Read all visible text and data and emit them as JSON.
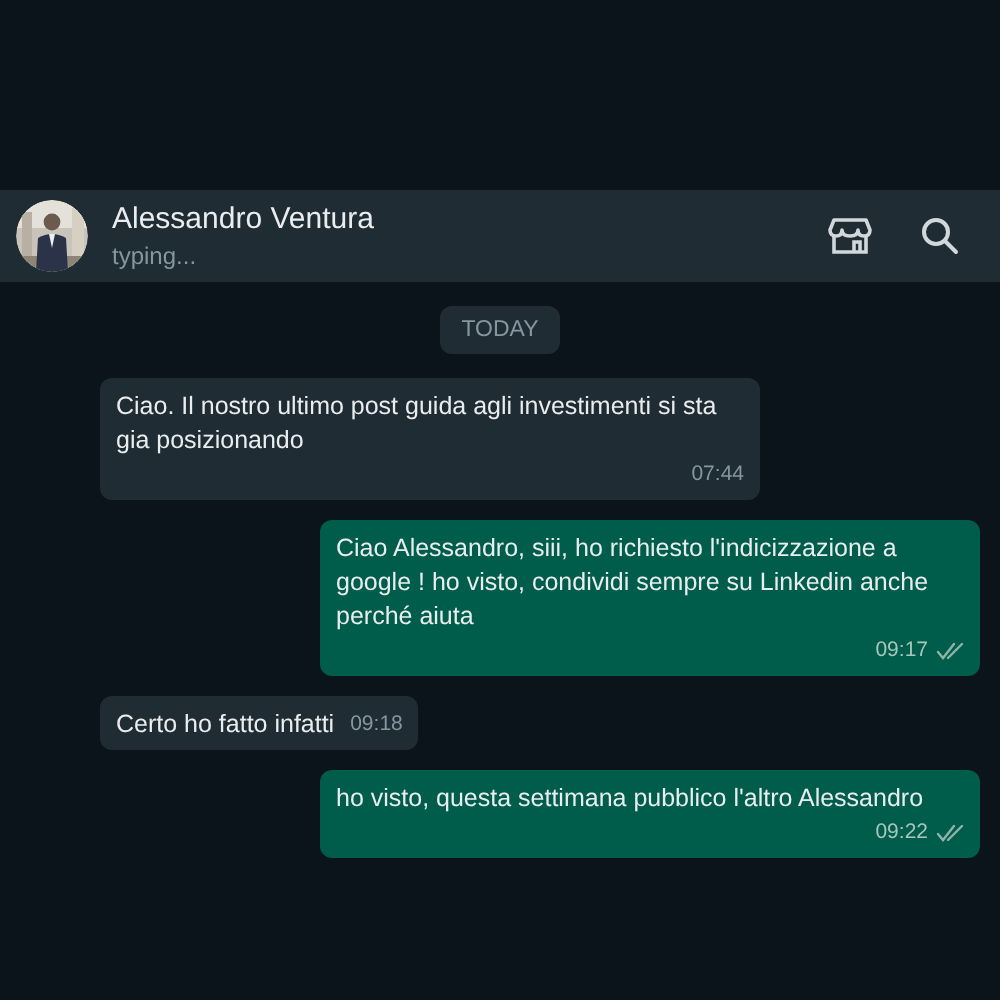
{
  "header": {
    "name": "Alessandro Ventura",
    "status": "typing..."
  },
  "date_chip": "TODAY",
  "messages": [
    {
      "kind": "incoming",
      "text": "Ciao. Il nostro ultimo post guida agli investimenti si sta gia posizionando",
      "time": "07:44"
    },
    {
      "kind": "outgoing",
      "text": "Ciao Alessandro, siii, ho richiesto l'indicizzazione a google ! ho visto, condividi sempre su Linkedin anche perché aiuta",
      "time": "09:17",
      "read": false
    },
    {
      "kind": "incoming",
      "text": "Certo ho fatto infatti",
      "time": "09:18"
    },
    {
      "kind": "outgoing",
      "text": "ho visto, questa settimana pubblico l'altro Alessandro",
      "time": "09:22",
      "read": false
    }
  ]
}
